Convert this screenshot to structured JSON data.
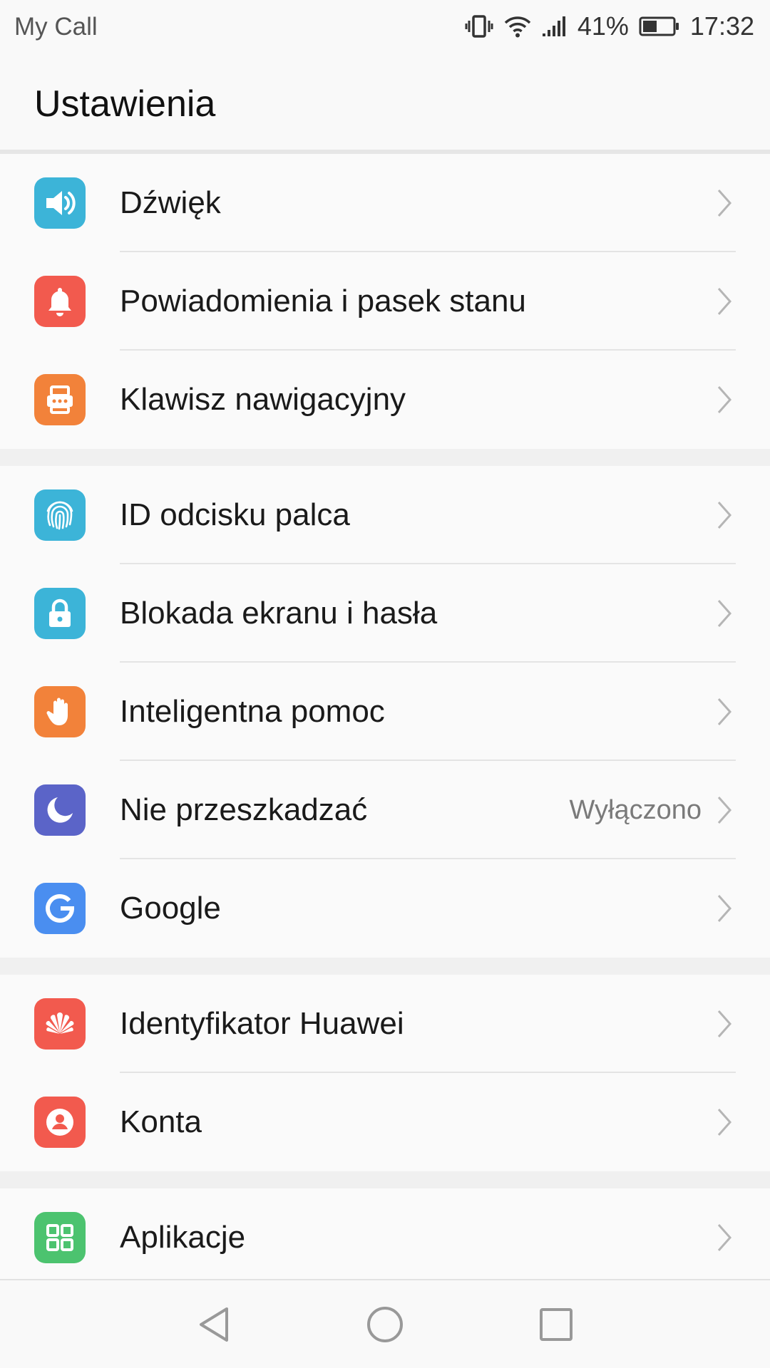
{
  "status_bar": {
    "app_name": "My Call",
    "battery_percent": "41%",
    "time": "17:32",
    "icons": [
      "vibrate-icon",
      "wifi-icon",
      "signal-icon",
      "battery-icon"
    ]
  },
  "header": {
    "title": "Ustawienia"
  },
  "groups": [
    {
      "items": [
        {
          "label": "Dźwięk",
          "icon": "speaker-icon",
          "color": "#3cb4d8"
        },
        {
          "label": "Powiadomienia i pasek stanu",
          "icon": "bell-icon",
          "color": "#f25a4e"
        },
        {
          "label": "Klawisz nawigacyjny",
          "icon": "navigation-key-icon",
          "color": "#f2823a"
        }
      ]
    },
    {
      "items": [
        {
          "label": "ID odcisku palca",
          "icon": "fingerprint-icon",
          "color": "#3cb4d8"
        },
        {
          "label": "Blokada ekranu i hasła",
          "icon": "lock-icon",
          "color": "#3cb4d8"
        },
        {
          "label": "Inteligentna pomoc",
          "icon": "hand-icon",
          "color": "#f2823a"
        },
        {
          "label": "Nie przeszkadzać",
          "value": "Wyłączono",
          "icon": "moon-icon",
          "color": "#5b64c8"
        },
        {
          "label": "Google",
          "icon": "google-icon",
          "color": "#4a8ef0"
        }
      ]
    },
    {
      "items": [
        {
          "label": "Identyfikator Huawei",
          "icon": "huawei-icon",
          "color": "#f25a4e"
        },
        {
          "label": "Konta",
          "icon": "account-icon",
          "color": "#f25a4e"
        }
      ]
    },
    {
      "items": [
        {
          "label": "Aplikacje",
          "icon": "apps-icon",
          "color": "#4cc36f"
        }
      ]
    }
  ],
  "nav_bar": {
    "icons": [
      "back-icon",
      "home-icon",
      "recents-icon"
    ]
  }
}
